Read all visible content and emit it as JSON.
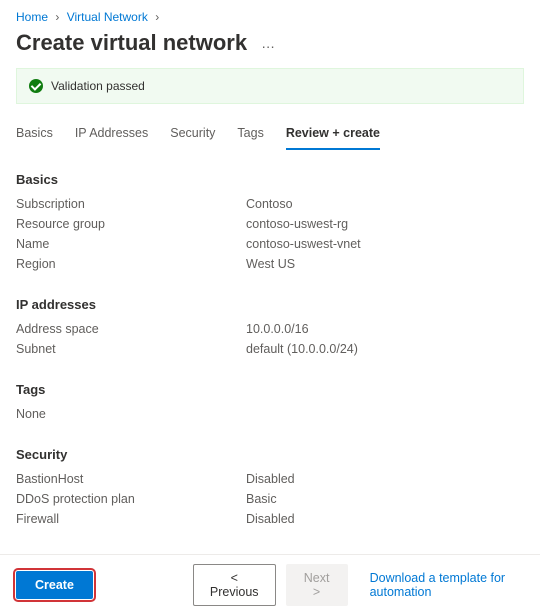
{
  "breadcrumb": {
    "items": [
      {
        "label": "Home"
      },
      {
        "label": "Virtual Network"
      }
    ]
  },
  "header": {
    "title": "Create virtual network"
  },
  "validation": {
    "message": "Validation passed"
  },
  "tabs": {
    "items": [
      {
        "label": "Basics",
        "active": false
      },
      {
        "label": "IP Addresses",
        "active": false
      },
      {
        "label": "Security",
        "active": false
      },
      {
        "label": "Tags",
        "active": false
      },
      {
        "label": "Review + create",
        "active": true
      }
    ]
  },
  "sections": {
    "basics": {
      "title": "Basics",
      "rows": [
        {
          "label": "Subscription",
          "value": "Contoso"
        },
        {
          "label": "Resource group",
          "value": "contoso-uswest-rg"
        },
        {
          "label": "Name",
          "value": "contoso-uswest-vnet"
        },
        {
          "label": "Region",
          "value": "West US"
        }
      ]
    },
    "ip": {
      "title": "IP addresses",
      "rows": [
        {
          "label": "Address space",
          "value": "10.0.0.0/16"
        },
        {
          "label": "Subnet",
          "value": "default (10.0.0.0/24)"
        }
      ]
    },
    "tags": {
      "title": "Tags",
      "rows": [
        {
          "label": "None",
          "value": ""
        }
      ]
    },
    "security": {
      "title": "Security",
      "rows": [
        {
          "label": "BastionHost",
          "value": "Disabled"
        },
        {
          "label": "DDoS protection plan",
          "value": "Basic"
        },
        {
          "label": "Firewall",
          "value": "Disabled"
        }
      ]
    }
  },
  "footer": {
    "create": "Create",
    "previous": "<  Previous",
    "next": "Next  >",
    "download": "Download a template for automation"
  }
}
